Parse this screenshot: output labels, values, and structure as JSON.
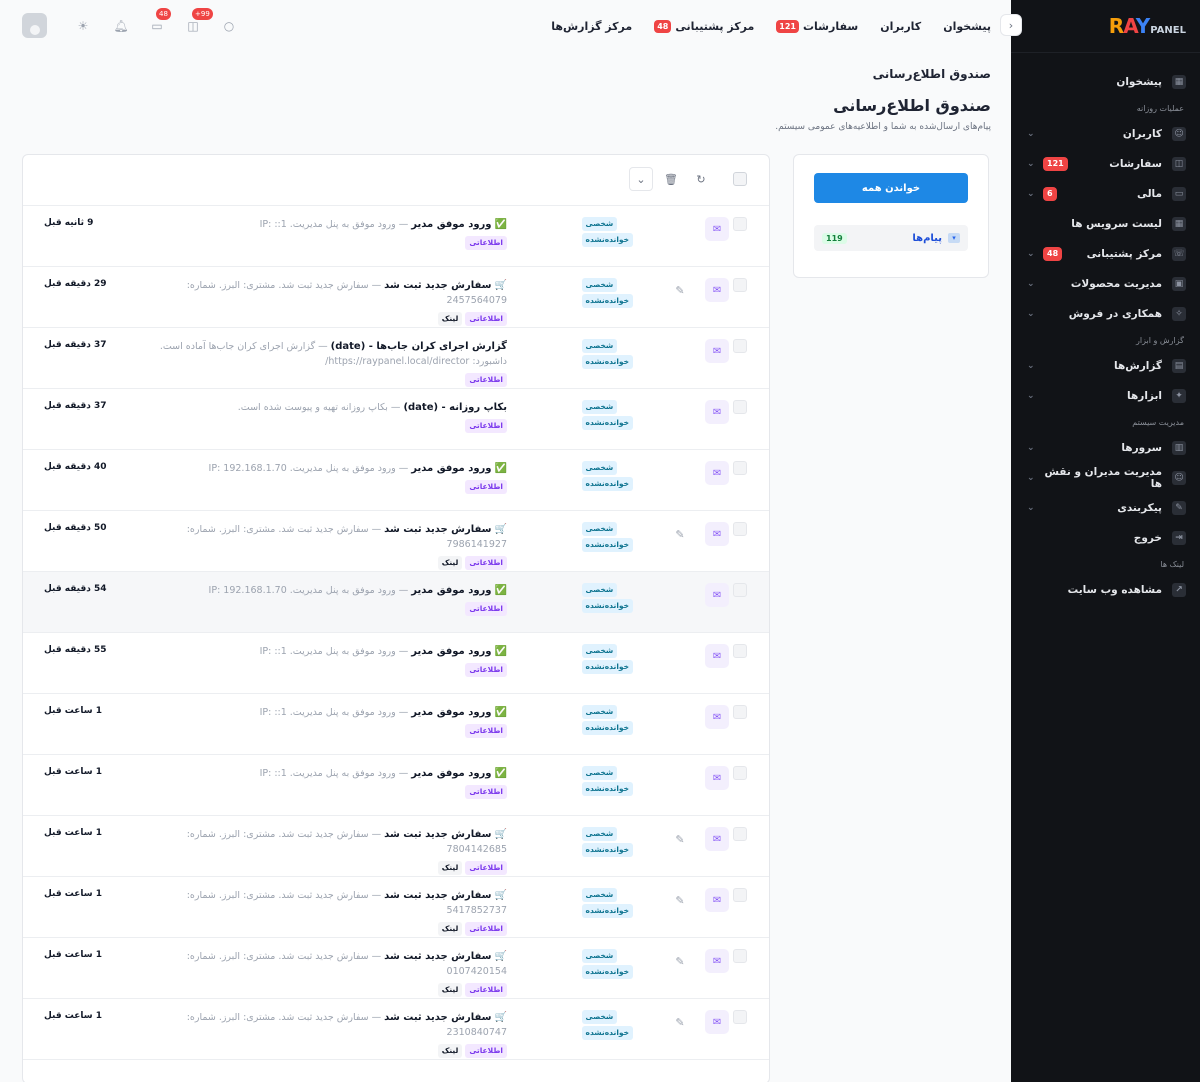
{
  "brand": {
    "logo_ray": "RAY",
    "logo_panel": "PANEL"
  },
  "sidebar": {
    "items": [
      {
        "type": "item",
        "label": "پیشخوان",
        "icon": "dashboard-icon",
        "badge": "",
        "chevron": false
      },
      {
        "type": "section",
        "label": "عملیات روزانه"
      },
      {
        "type": "item",
        "label": "کاربران",
        "icon": "users-icon",
        "badge": "",
        "chevron": true
      },
      {
        "type": "item",
        "label": "سفارشات",
        "icon": "basket-icon",
        "badge": "121",
        "chevron": true
      },
      {
        "type": "item",
        "label": "مالی",
        "icon": "wallet-icon",
        "badge": "6",
        "chevron": true
      },
      {
        "type": "item",
        "label": "لیست سرویس ها",
        "icon": "grid-icon",
        "badge": "",
        "chevron": false
      },
      {
        "type": "item",
        "label": "مرکز پشتیبانی",
        "icon": "support-icon",
        "badge": "48",
        "chevron": true
      },
      {
        "type": "item",
        "label": "مدیریت محصولات",
        "icon": "box-icon",
        "badge": "",
        "chevron": true
      },
      {
        "type": "item",
        "label": "همکاری در فروش",
        "icon": "handshake-icon",
        "badge": "",
        "chevron": true
      },
      {
        "type": "section",
        "label": "گزارش و ابزار"
      },
      {
        "type": "item",
        "label": "گزارش‌ها",
        "icon": "report-icon",
        "badge": "",
        "chevron": true
      },
      {
        "type": "item",
        "label": "ابزارها",
        "icon": "tools-icon",
        "badge": "",
        "chevron": true
      },
      {
        "type": "section",
        "label": "مدیریت سیستم"
      },
      {
        "type": "item",
        "label": "سرورها",
        "icon": "server-icon",
        "badge": "",
        "chevron": true
      },
      {
        "type": "item",
        "label": "مدیریت مدیران و نقش ها",
        "icon": "admins-icon",
        "badge": "",
        "chevron": true
      },
      {
        "type": "item",
        "label": "پیکربندی",
        "icon": "settings-icon",
        "badge": "",
        "chevron": true
      },
      {
        "type": "item",
        "label": "خروج",
        "icon": "logout-icon",
        "badge": "",
        "chevron": false
      },
      {
        "type": "section",
        "label": "لینک ها"
      },
      {
        "type": "item",
        "label": "مشاهده وب سایت",
        "icon": "external-link-icon",
        "badge": "",
        "chevron": false
      }
    ]
  },
  "topnav": [
    {
      "label": "پیشخوان",
      "badge": ""
    },
    {
      "label": "کاربران",
      "badge": ""
    },
    {
      "label": "سفارشات",
      "badge": "121"
    },
    {
      "label": "مرکز پشتیبانی",
      "badge": "48"
    },
    {
      "label": "مرکز گزارش‌ها",
      "badge": ""
    }
  ],
  "topicons": {
    "cart_badge": "+99",
    "messages_badge": "48"
  },
  "breadcrumb": "صندوق اطلاع‌رسانی",
  "page": {
    "title": "صندوق اطلاع‌رسانی",
    "subtitle": "پیام‌های ارسال‌شده به شما و اطلاعیه‌های عمومی سیستم."
  },
  "side_card": {
    "read_all": "خواندن همه",
    "folder_label": "پیام‌ها",
    "folder_count": "119"
  },
  "notifications": [
    {
      "emoji": "✅",
      "title": "ورود موفق مدیر",
      "desc": "ورود موفق به پنل مدیریت. IP: ::1",
      "tags": [
        "اطلاعاتی"
      ],
      "time": "9 ثانیه قبل",
      "status": [
        "شخصی",
        "خوانده‌نشده"
      ],
      "action": false
    },
    {
      "emoji": "🛒",
      "title": "سفارش جدید ثبت شد",
      "desc": "سفارش جدید ثبت شد. مشتری: البرز. شماره: 2457564079",
      "tags": [
        "اطلاعاتی",
        "لینک"
      ],
      "time": "29 دقیقه قبل",
      "status": [
        "شخصی",
        "خوانده‌نشده"
      ],
      "action": true
    },
    {
      "emoji": "",
      "title": "گزارش اجرای کران جاب‌ها - (date)",
      "desc": "گزارش اجرای کران جاب‌ها آماده است. داشبورد: https://raypanel.local/director/",
      "tags": [
        "اطلاعاتی"
      ],
      "time": "37 دقیقه قبل",
      "status": [
        "شخصی",
        "خوانده‌نشده"
      ],
      "action": false
    },
    {
      "emoji": "",
      "title": "بکاپ روزانه - (date)",
      "desc": "بکاپ روزانه تهیه و پیوست شده است.",
      "tags": [
        "اطلاعاتی"
      ],
      "time": "37 دقیقه قبل",
      "status": [
        "شخصی",
        "خوانده‌نشده"
      ],
      "action": false
    },
    {
      "emoji": "✅",
      "title": "ورود موفق مدیر",
      "desc": "ورود موفق به پنل مدیریت. IP: 192.168.1.70",
      "tags": [
        "اطلاعاتی"
      ],
      "time": "40 دقیقه قبل",
      "status": [
        "شخصی",
        "خوانده‌نشده"
      ],
      "action": false
    },
    {
      "emoji": "🛒",
      "title": "سفارش جدید ثبت شد",
      "desc": "سفارش جدید ثبت شد. مشتری: البرز. شماره: 7986141927",
      "tags": [
        "اطلاعاتی",
        "لینک"
      ],
      "time": "50 دقیقه قبل",
      "status": [
        "شخصی",
        "خوانده‌نشده"
      ],
      "action": true
    },
    {
      "emoji": "✅",
      "title": "ورود موفق مدیر",
      "desc": "ورود موفق به پنل مدیریت. IP: 192.168.1.70",
      "tags": [
        "اطلاعاتی"
      ],
      "time": "54 دقیقه قبل",
      "status": [
        "شخصی",
        "خوانده‌نشده"
      ],
      "action": false
    },
    {
      "emoji": "✅",
      "title": "ورود موفق مدیر",
      "desc": "ورود موفق به پنل مدیریت. IP: ::1",
      "tags": [
        "اطلاعاتی"
      ],
      "time": "55 دقیقه قبل",
      "status": [
        "شخصی",
        "خوانده‌نشده"
      ],
      "action": false
    },
    {
      "emoji": "✅",
      "title": "ورود موفق مدیر",
      "desc": "ورود موفق به پنل مدیریت. IP: ::1",
      "tags": [
        "اطلاعاتی"
      ],
      "time": "1 ساعت قبل",
      "status": [
        "شخصی",
        "خوانده‌نشده"
      ],
      "action": false
    },
    {
      "emoji": "✅",
      "title": "ورود موفق مدیر",
      "desc": "ورود موفق به پنل مدیریت. IP: ::1",
      "tags": [
        "اطلاعاتی"
      ],
      "time": "1 ساعت قبل",
      "status": [
        "شخصی",
        "خوانده‌نشده"
      ],
      "action": false
    },
    {
      "emoji": "🛒",
      "title": "سفارش جدید ثبت شد",
      "desc": "سفارش جدید ثبت شد. مشتری: البرز. شماره: 7804142685",
      "tags": [
        "اطلاعاتی",
        "لینک"
      ],
      "time": "1 ساعت قبل",
      "status": [
        "شخصی",
        "خوانده‌نشده"
      ],
      "action": true
    },
    {
      "emoji": "🛒",
      "title": "سفارش جدید ثبت شد",
      "desc": "سفارش جدید ثبت شد. مشتری: البرز. شماره: 5417852737",
      "tags": [
        "اطلاعاتی",
        "لینک"
      ],
      "time": "1 ساعت قبل",
      "status": [
        "شخصی",
        "خوانده‌نشده"
      ],
      "action": true
    },
    {
      "emoji": "🛒",
      "title": "سفارش جدید ثبت شد",
      "desc": "سفارش جدید ثبت شد. مشتری: البرز. شماره: 0107420154",
      "tags": [
        "اطلاعاتی",
        "لینک"
      ],
      "time": "1 ساعت قبل",
      "status": [
        "شخصی",
        "خوانده‌نشده"
      ],
      "action": true
    },
    {
      "emoji": "🛒",
      "title": "سفارش جدید ثبت شد",
      "desc": "سفارش جدید ثبت شد. مشتری: البرز. شماره: 2310840747",
      "tags": [
        "اطلاعاتی",
        "لینک"
      ],
      "time": "1 ساعت قبل",
      "status": [
        "شخصی",
        "خوانده‌نشده"
      ],
      "action": true
    }
  ],
  "colors": {
    "primary": "#1e88e5",
    "sidebar_bg": "#111317",
    "badge": "#ef4444",
    "tag_purple": "#7c3aed",
    "tag_teal": "#0e7490"
  }
}
